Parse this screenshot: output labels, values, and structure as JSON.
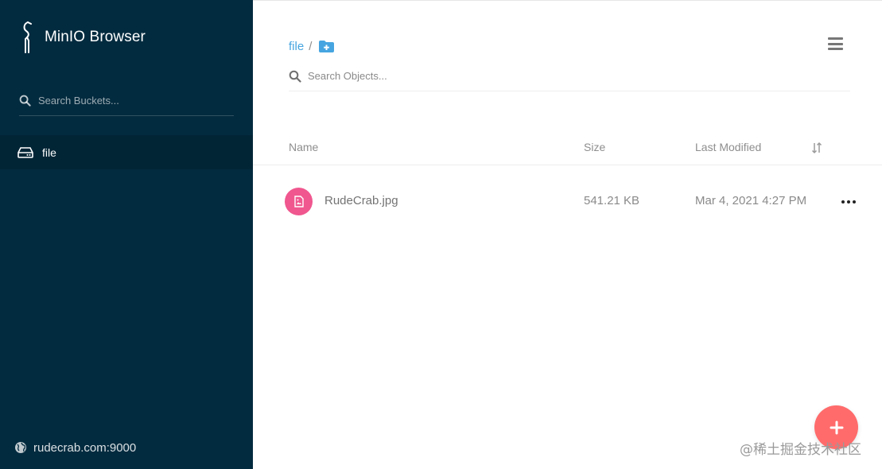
{
  "sidebar": {
    "brand_title": "MinIO Browser",
    "search_placeholder": "Search Buckets...",
    "buckets": [
      {
        "label": "file",
        "icon": "hard-drive-icon",
        "active": true
      }
    ],
    "host": "rudecrab.com:9000",
    "background": "#032b3f"
  },
  "main": {
    "breadcrumb": {
      "current": "file",
      "separator": "/"
    },
    "search_placeholder": "Search Objects...",
    "table": {
      "columns": {
        "name": "Name",
        "size": "Size",
        "modified": "Last Modified"
      },
      "rows": [
        {
          "name": "RudeCrab.jpg",
          "size": "541.21 KB",
          "modified": "Mar 4, 2021 4:27 PM",
          "icon": "image-file-icon"
        }
      ]
    }
  },
  "watermark": "@稀土掘金技术社区",
  "colors": {
    "accent": "#46a5e0",
    "file_icon": "#f0578e",
    "fab": "#ff6b6b"
  }
}
